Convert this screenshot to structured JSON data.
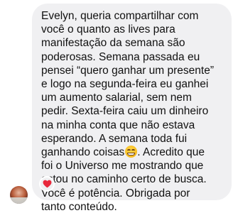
{
  "message": {
    "lines": [
      "Evelyn, queria compartilhar com",
      "você o quanto as lives para",
      "manifestação da semana são",
      "poderosas. Semana passada eu",
      "pensei “quero ganhar um presente”",
      "e logo na segunda-feira eu ganhei",
      "um aumento salarial, sem nem",
      "pedir. Sexta-feira caiu um dinheiro",
      "na minha conta que não estava",
      "esperando. A semana toda fui",
      "ganhando coisas",
      ". Acredito que",
      "foi o Universo me mostrando que",
      "estou no caminho certo de busca.",
      "Você é potência. Obrigada por",
      "tanto conteúdo."
    ],
    "inline_emoji": "grinning-face-emoji"
  },
  "reaction": {
    "icon": "heart-icon",
    "color": "#e8283c"
  },
  "avatar": {
    "icon": "profile-photo"
  },
  "colors": {
    "bubble": "#f0f0f2",
    "text": "#111111",
    "background": "#ffffff"
  }
}
